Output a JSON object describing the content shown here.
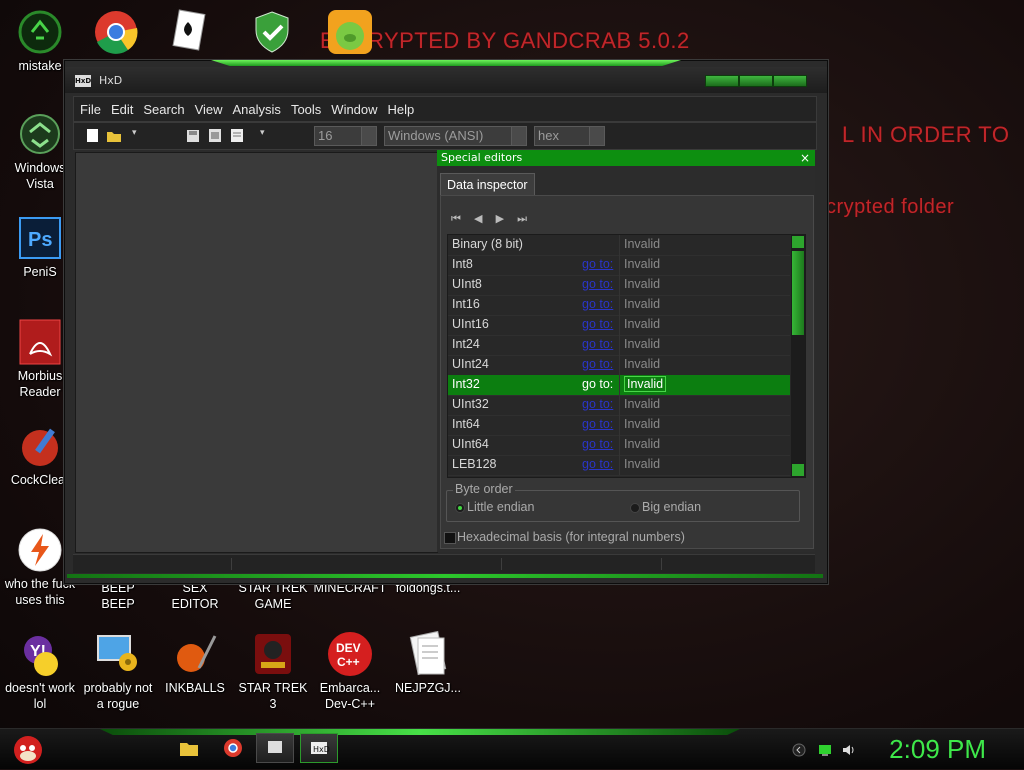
{
  "desktop": {
    "ransom_lines": [
      {
        "text": "ENCRYPTED BY GANDCRAB 5.0.2"
      },
      {
        "text": "L IN ORDER TO"
      },
      {
        "text": "crypted folder"
      }
    ],
    "icons_left": [
      {
        "label": "mistake"
      },
      {
        "label": "Windows\nVista"
      },
      {
        "label": "PeniS"
      },
      {
        "label": "Morbius\nReader"
      },
      {
        "label": "CockClear"
      },
      {
        "label": "who the fuck\nuses this"
      }
    ],
    "icons_row_mid": [
      {
        "label": "BEEP\nBEEP"
      },
      {
        "label": "SEX\nEDITOR"
      },
      {
        "label": "STAR TREK\nGAME"
      },
      {
        "label": "MINECRAFT"
      },
      {
        "label": "foldongs.t..."
      }
    ],
    "icons_row_bottom": [
      {
        "label": "doesn't work\nlol"
      },
      {
        "label": "probably not\na rogue"
      },
      {
        "label": "INKBALLS"
      },
      {
        "label": "STAR TREK\n3"
      },
      {
        "label": "Embarca...\nDev-C++"
      },
      {
        "label": "NEJPZGJ..."
      }
    ],
    "accent_color": "#47e047",
    "ransom_color": "#c0262a"
  },
  "window": {
    "title": "HxD",
    "icon_text": "HxD",
    "menu": [
      "File",
      "Edit",
      "Search",
      "View",
      "Analysis",
      "Tools",
      "Window",
      "Help"
    ],
    "toolbar": {
      "bytes_per_row": "16",
      "charset": "Windows (ANSI)",
      "offset_base": "hex"
    },
    "special_editors": {
      "header": "Special editors",
      "close": "×",
      "tab": "Data inspector",
      "rows": [
        {
          "type": "Binary (8 bit)",
          "goto": "",
          "value": "Invalid"
        },
        {
          "type": "Int8",
          "goto": "go to:",
          "value": "Invalid"
        },
        {
          "type": "UInt8",
          "goto": "go to:",
          "value": "Invalid"
        },
        {
          "type": "Int16",
          "goto": "go to:",
          "value": "Invalid"
        },
        {
          "type": "UInt16",
          "goto": "go to:",
          "value": "Invalid"
        },
        {
          "type": "Int24",
          "goto": "go to:",
          "value": "Invalid"
        },
        {
          "type": "UInt24",
          "goto": "go to:",
          "value": "Invalid"
        },
        {
          "type": "Int32",
          "goto": "go to:",
          "value": "Invalid",
          "selected": true
        },
        {
          "type": "UInt32",
          "goto": "go to:",
          "value": "Invalid"
        },
        {
          "type": "Int64",
          "goto": "go to:",
          "value": "Invalid"
        },
        {
          "type": "UInt64",
          "goto": "go to:",
          "value": "Invalid"
        },
        {
          "type": "LEB128",
          "goto": "go to:",
          "value": "Invalid"
        }
      ],
      "byte_order": {
        "title": "Byte order",
        "little": "Little endian",
        "big": "Big endian",
        "selected": "little"
      },
      "hex_basis": "Hexadecimal basis (for integral numbers)"
    }
  },
  "taskbar": {
    "clock": "2:09 PM"
  }
}
